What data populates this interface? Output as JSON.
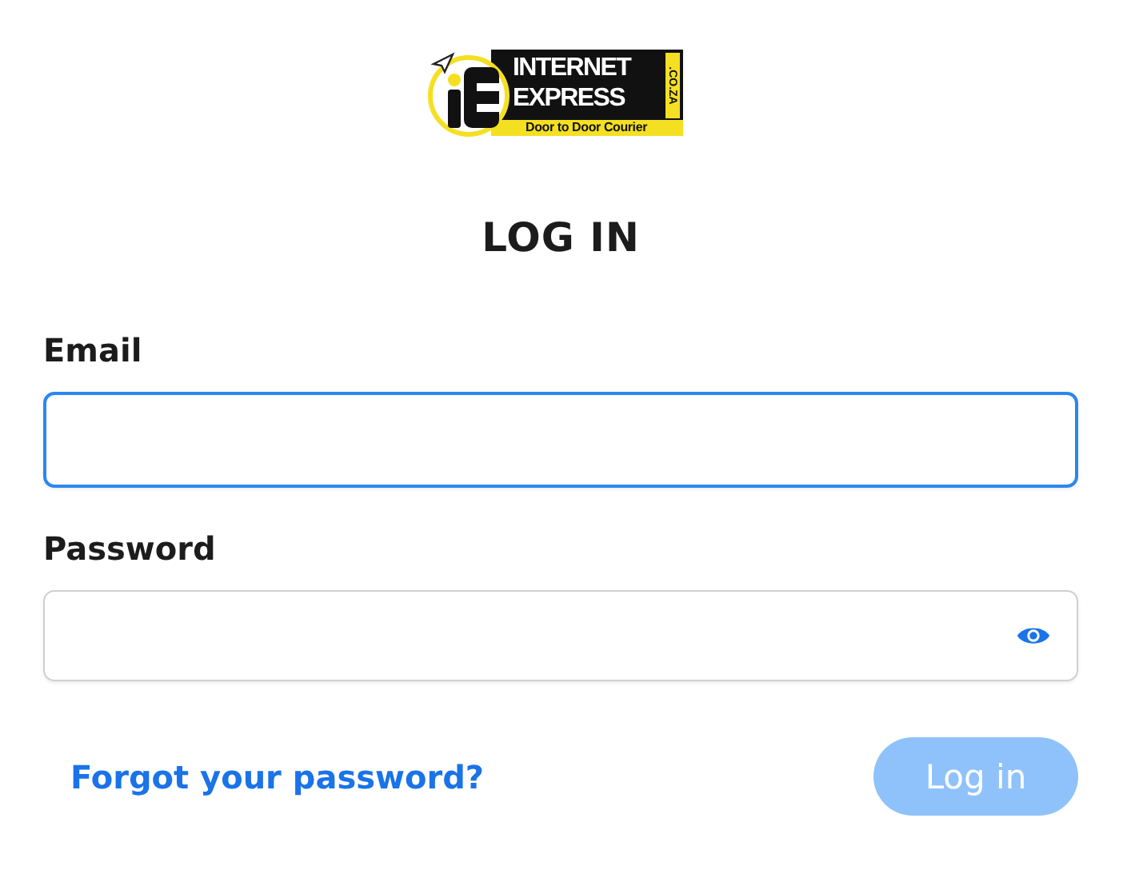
{
  "logo": {
    "line_1": "INTERNET",
    "line_2": "EXPRESS",
    "domain": ".CO.ZA",
    "tagline": "Door to Door Courier"
  },
  "title": "LOG IN",
  "fields": [
    {
      "label": "Email",
      "kind": "text",
      "focused": true
    },
    {
      "label": "Password",
      "kind": "password",
      "focused": false
    }
  ],
  "forgot_link": "Forgot your password?",
  "login_button": {
    "label": "Log in",
    "disabled": true
  }
}
